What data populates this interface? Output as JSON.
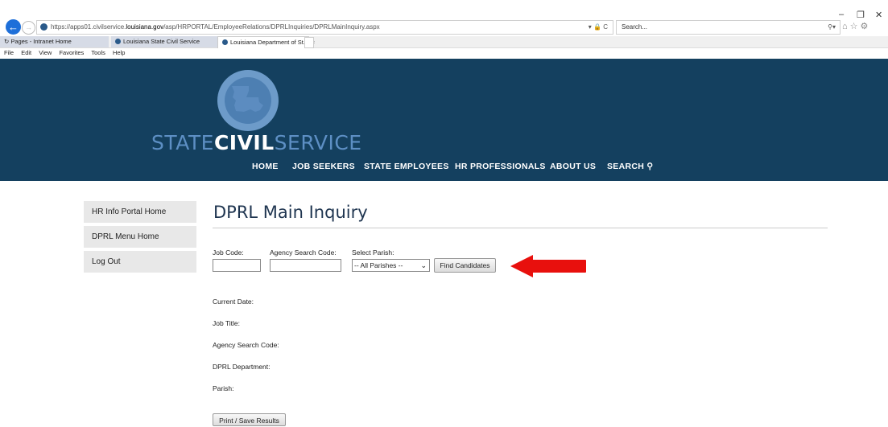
{
  "browser": {
    "url_prefix": "https://apps01.civilservice.",
    "url_domain": "louisiana.gov",
    "url_path": "/asp/HRPORTAL/EmployeeRelations/DPRLInquiries/DPRLMainInquiry.aspx",
    "addr_icons": "▾ 🔒 C",
    "search_placeholder": "Search...",
    "search_icon": "⚲▾",
    "win_min": "–",
    "win_restore": "❐",
    "win_close": "✕",
    "toolbar_icons": "⌂☆⚙",
    "back_icon": "←",
    "fwd_icon": "→",
    "tabs": [
      {
        "label": "Pages - Intranet Home",
        "icon": "refresh-icon"
      },
      {
        "label": "Louisiana State Civil Service",
        "icon": "site-icon"
      },
      {
        "label": "Louisiana Department of St...",
        "icon": "site-icon",
        "close": "×"
      }
    ],
    "menu": [
      "File",
      "Edit",
      "View",
      "Favorites",
      "Tools",
      "Help"
    ]
  },
  "header": {
    "brand_state": "STATE",
    "brand_civil": "CIVIL",
    "brand_service": "SERVICE",
    "nav": [
      "HOME",
      "JOB SEEKERS",
      "STATE EMPLOYEES",
      "HR PROFESSIONALS",
      "ABOUT US",
      "SEARCH"
    ],
    "colors": {
      "header_bg": "#14405f",
      "logo_light": "#6d9bc9"
    }
  },
  "sidebar": {
    "items": [
      {
        "label": "HR Info Portal Home"
      },
      {
        "label": "DPRL Menu Home"
      },
      {
        "label": "Log Out"
      }
    ]
  },
  "main": {
    "title": "DPRL Main Inquiry",
    "job_code_label": "Job Code:",
    "job_code_value": "",
    "agency_code_label": "Agency Search Code:",
    "agency_code_value": "",
    "parish_label": "Select Parish:",
    "parish_selected": "-- All Parishes --",
    "find_button": "Find Candidates",
    "results": {
      "current_date": "Current Date:",
      "job_title": "Job Title:",
      "agency_search_code": "Agency Search Code:",
      "dprl_department": "DPRL Department:",
      "parish": "Parish:"
    },
    "print_button": "Print / Save Results",
    "annotation_color": "#e8100d"
  }
}
